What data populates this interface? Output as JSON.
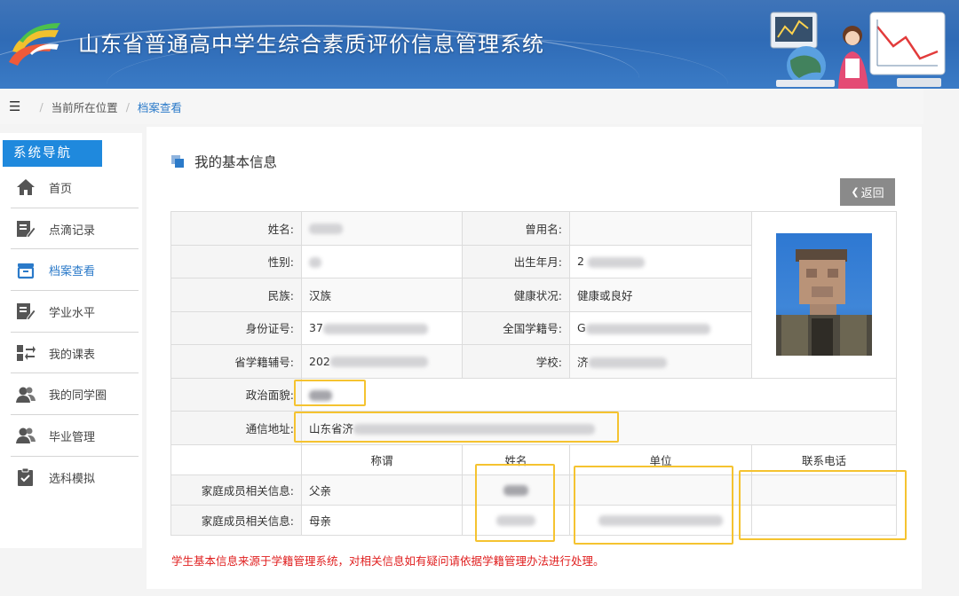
{
  "header": {
    "title": "山东省普通高中学生综合素质评价信息管理系统"
  },
  "breadcrumb": {
    "prefix": "当前所在位置",
    "current": "档案查看"
  },
  "sidebar": {
    "title": "系统导航",
    "items": [
      {
        "label": "首页",
        "icon": "home-icon"
      },
      {
        "label": "点滴记录",
        "icon": "edit-note-icon"
      },
      {
        "label": "档案查看",
        "icon": "archive-box-icon"
      },
      {
        "label": "学业水平",
        "icon": "edit-doc-icon"
      },
      {
        "label": "我的课表",
        "icon": "swap-arrows-icon"
      },
      {
        "label": "我的同学圈",
        "icon": "users-icon"
      },
      {
        "label": "毕业管理",
        "icon": "user-group-icon"
      },
      {
        "label": "选科模拟",
        "icon": "clipboard-check-icon"
      }
    ],
    "active_index": 2
  },
  "main": {
    "section_title": "我的基本信息",
    "back_label": "返回",
    "fields": {
      "name_label": "姓名:",
      "former_name_label": "曾用名:",
      "gender_label": "性别:",
      "birth_label": "出生年月:",
      "birth_value_prefix": "2",
      "ethnicity_label": "民族:",
      "ethnicity_value": "汉族",
      "health_label": "健康状况:",
      "health_value": "健康或良好",
      "id_label": "身份证号:",
      "id_value_prefix": "37",
      "national_no_label": "全国学籍号:",
      "national_no_prefix": "G",
      "province_no_label": "省学籍辅号:",
      "province_no_prefix": "202",
      "school_label": "学校:",
      "school_prefix": "济",
      "political_label": "政治面貌:",
      "address_label": "通信地址:",
      "address_prefix": "山东省济"
    },
    "family": {
      "headers": [
        "称谓",
        "姓名",
        "单位",
        "联系电话"
      ],
      "row_label": "家庭成员相关信息:",
      "rows": [
        {
          "relation": "父亲"
        },
        {
          "relation": "母亲"
        }
      ]
    },
    "note": "学生基本信息来源于学籍管理系统，对相关信息如有疑问请依据学籍管理办法进行处理。",
    "highlight_color": "#f5c330"
  },
  "colors": {
    "accent": "#2b7ac9",
    "nav_head": "#1f89dd",
    "note": "#e02020"
  }
}
